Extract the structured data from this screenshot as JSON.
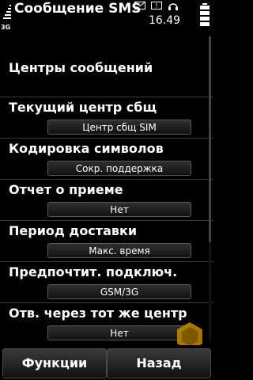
{
  "header": {
    "title": "Сообщение SMS",
    "clock": "16.49",
    "network_indicator": "3G",
    "icons": [
      "signal-bars-icon",
      "envelope-icon",
      "alert-icon",
      "headset-icon",
      "battery-icon"
    ]
  },
  "content": {
    "section_title": "Центры сообщений",
    "settings": [
      {
        "label": "Текущий центр сбщ",
        "value": "Центр сбщ SIM"
      },
      {
        "label": "Кодировка символов",
        "value": "Сокр. поддержка"
      },
      {
        "label": "Отчет о приеме",
        "value": "Нет"
      },
      {
        "label": "Период доставки",
        "value": "Макс. время"
      },
      {
        "label": "Предпочтит. подключ.",
        "value": "GSM/3G"
      },
      {
        "label": "Отв. через тот же центр",
        "value": "Нет"
      }
    ]
  },
  "softkeys": {
    "left": "Функции",
    "right": "Назад"
  }
}
